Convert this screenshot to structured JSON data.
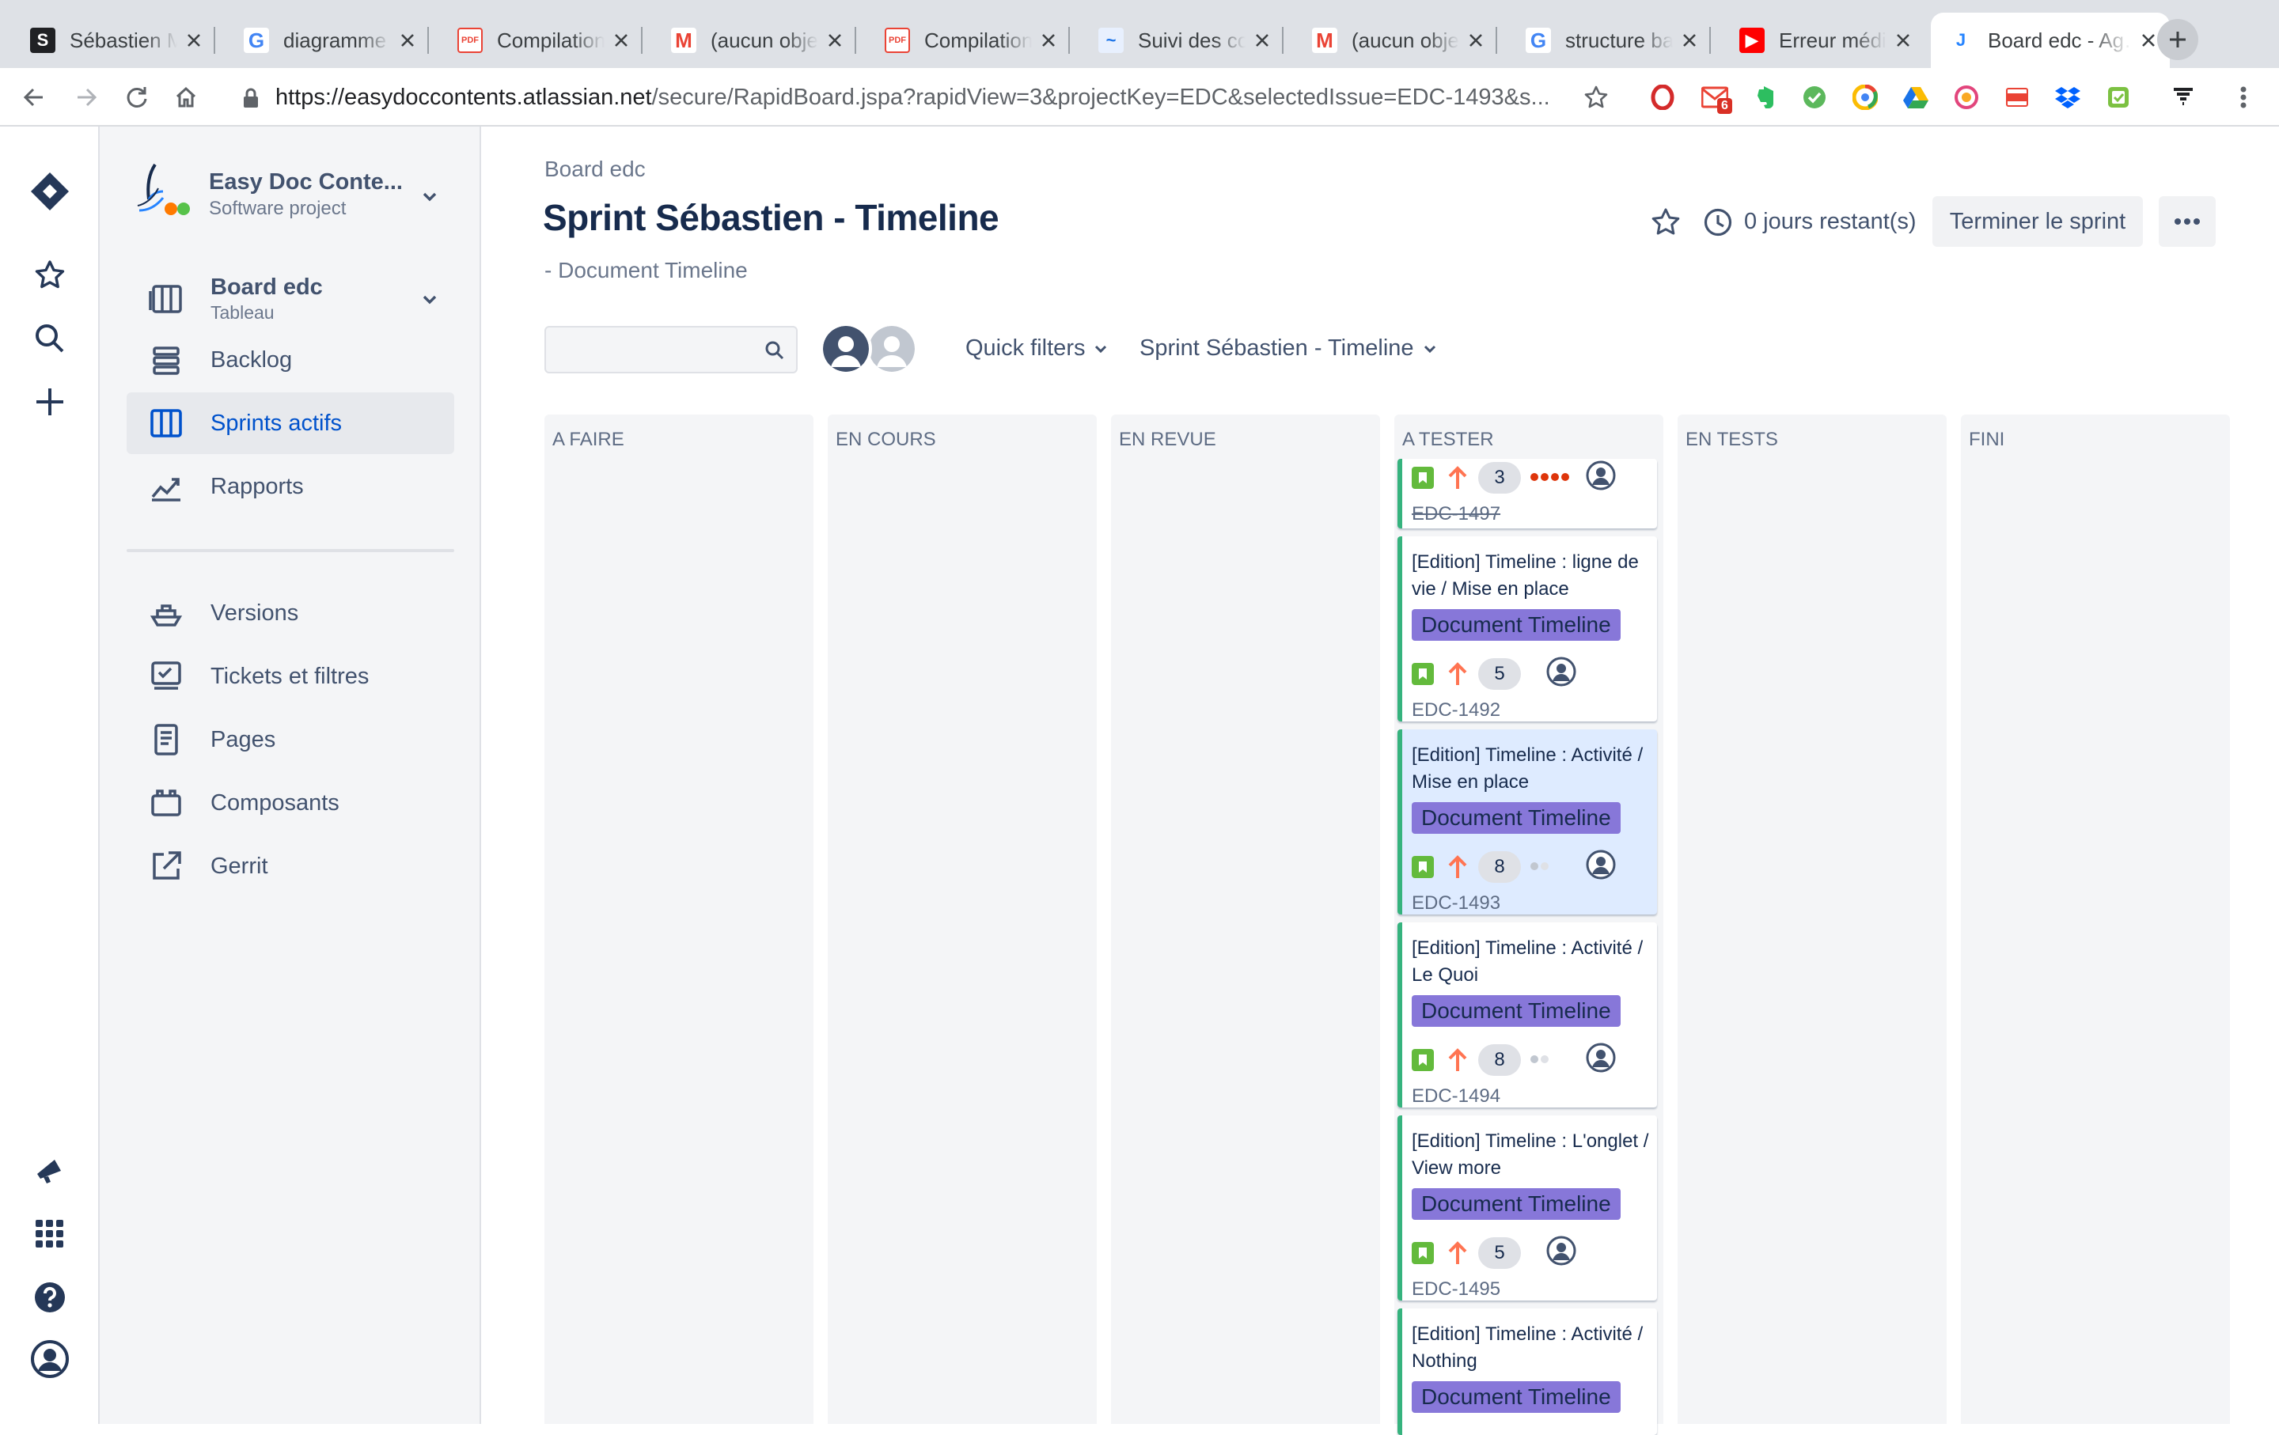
{
  "browser": {
    "tabs": [
      {
        "title": "Sébastien Mart…",
        "favicon": "s-logo-icon",
        "color": "#202124",
        "glyph": "S"
      },
      {
        "title": "diagramme de…",
        "favicon": "google-icon",
        "color": "#4285f4",
        "glyph": "G"
      },
      {
        "title": "Compilation",
        "favicon": "pdf-icon",
        "color": "#ea4335",
        "glyph": "PDF"
      },
      {
        "title": "(aucun objet)",
        "favicon": "gmail-icon",
        "color": "#ea4335",
        "glyph": "M"
      },
      {
        "title": "Compilation",
        "favicon": "pdf-icon",
        "color": "#ea4335",
        "glyph": "PDF"
      },
      {
        "title": "Suivi des cong…",
        "favicon": "chart-icon",
        "color": "#1a73e8",
        "glyph": "~"
      },
      {
        "title": "(aucun objet)",
        "favicon": "gmail-icon",
        "color": "#ea4335",
        "glyph": "M"
      },
      {
        "title": "structure bas…",
        "favicon": "google-icon",
        "color": "#4285f4",
        "glyph": "G"
      },
      {
        "title": "Erreur médic…",
        "favicon": "youtube-icon",
        "color": "#ff0000",
        "glyph": "▶"
      },
      {
        "title": "Board edc - Ag…",
        "favicon": "jira-project-icon",
        "color": "#2684ff",
        "glyph": "J"
      }
    ],
    "active_tab": 9,
    "url_host": "https://easydoccontents.atlassian.net",
    "url_path": "/secure/RapidBoard.jspa?rapidView=3&projectKey=EDC&selectedIssue=EDC-1493&s...",
    "gmail_badge": "6"
  },
  "sidebar": {
    "project_name": "Easy Doc Conte...",
    "project_type": "Software project",
    "board_name": "Board edc",
    "board_sub": "Tableau",
    "items": [
      {
        "label": "Backlog",
        "icon": "backlog-icon"
      },
      {
        "label": "Sprints actifs",
        "icon": "board-columns-icon",
        "selected": true
      },
      {
        "label": "Rapports",
        "icon": "reports-chart-icon"
      }
    ],
    "items2": [
      {
        "label": "Versions",
        "icon": "ship-icon"
      },
      {
        "label": "Tickets et filtres",
        "icon": "issues-filters-icon"
      },
      {
        "label": "Pages",
        "icon": "page-icon"
      },
      {
        "label": "Composants",
        "icon": "components-icon"
      },
      {
        "label": "Gerrit",
        "icon": "external-link-icon"
      }
    ]
  },
  "header": {
    "breadcrumb": "Board edc",
    "title": "Sprint Sébastien - Timeline",
    "subtitle": "- Document Timeline",
    "days_remaining": "0 jours restant(s)",
    "end_sprint": "Terminer le sprint"
  },
  "filters": {
    "search_placeholder": "",
    "quick_filters": "Quick filters",
    "sprint_select": "Sprint Sébastien - Timeline"
  },
  "columns": [
    "A FAIRE",
    "EN COURS",
    "EN REVUE",
    "A TESTER",
    "EN TESTS",
    "FINI"
  ],
  "cards": [
    {
      "summary": "",
      "epic": "",
      "estimate": "3",
      "key": "EDC-1497",
      "done": true,
      "dots": [
        "#de350b",
        "#de350b",
        "#de350b",
        "#de350b"
      ],
      "highlight": false
    },
    {
      "summary": "[Edition] Timeline : ligne de vie / Mise en place",
      "epic": "Document Timeline",
      "estimate": "5",
      "key": "EDC-1492",
      "done": false,
      "dots": [],
      "highlight": false
    },
    {
      "summary": "[Edition] Timeline : Activité / Mise en place",
      "epic": "Document Timeline",
      "estimate": "8",
      "key": "EDC-1493",
      "done": false,
      "dots": [
        "#c1c7d0",
        "#dfe1e6"
      ],
      "highlight": true
    },
    {
      "summary": "[Edition] Timeline : Activité / Le Quoi",
      "epic": "Document Timeline",
      "estimate": "8",
      "key": "EDC-1494",
      "done": false,
      "dots": [
        "#c1c7d0",
        "#dfe1e6"
      ],
      "highlight": false
    },
    {
      "summary": "[Edition] Timeline : L'onglet / View more",
      "epic": "Document Timeline",
      "estimate": "5",
      "key": "EDC-1495",
      "done": false,
      "dots": [],
      "highlight": false
    },
    {
      "summary": "[Edition] Timeline : Activité / Nothing",
      "epic": "Document Timeline",
      "estimate": "",
      "key": "",
      "done": false,
      "dots": [],
      "highlight": false
    }
  ],
  "colors": {
    "accent": "#0052cc",
    "epic": "#8777d9",
    "story": "#63ba3c",
    "priority": "#ff7452"
  }
}
